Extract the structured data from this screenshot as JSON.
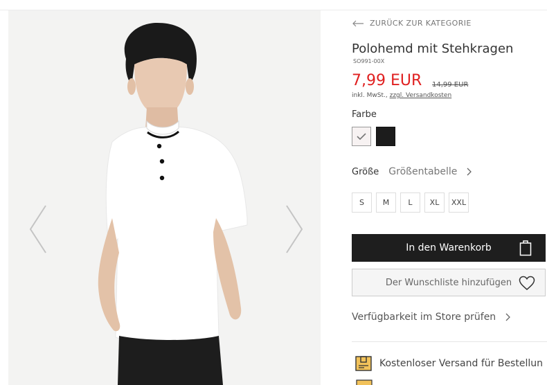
{
  "nav": {
    "back_label": "ZURÜCK ZUR KATEGORIE"
  },
  "product": {
    "title": "Polohemd mit Stehkragen",
    "sku": "SO991-00X",
    "price": "7,99 EUR",
    "old_price": "14,99 EUR",
    "tax_note": "inkl. MwSt.,",
    "shipping_link": "zzgl. Versandkosten"
  },
  "colors": {
    "label": "Farbe",
    "options": [
      {
        "name": "white",
        "hex": "#f7f2f2",
        "selected": true
      },
      {
        "name": "black",
        "hex": "#1c1c1c",
        "selected": false
      }
    ]
  },
  "size": {
    "label": "Größe",
    "chart_link": "Größentabelle",
    "options": [
      "S",
      "M",
      "L",
      "XL",
      "XXL"
    ]
  },
  "actions": {
    "add_to_cart": "In den Warenkorb",
    "wishlist": "Der Wunschliste hinzufügen",
    "store_availability": "Verfügbarkeit im Store prüfen"
  },
  "benefits": {
    "free_shipping": "Kostenloser Versand für Bestellun"
  },
  "icons": {
    "back": "arrow-left-icon",
    "gallery_prev": "chevron-left-icon",
    "gallery_next": "chevron-right-icon",
    "swatch_check": "check-icon",
    "cart": "shopping-bag-icon",
    "wishlist": "heart-icon",
    "shipping": "package-icon"
  },
  "colors_theme": {
    "price_red": "#e02020",
    "cart_button_bg": "#1e1e1e",
    "wishlist_bg": "#f5f5f5"
  }
}
